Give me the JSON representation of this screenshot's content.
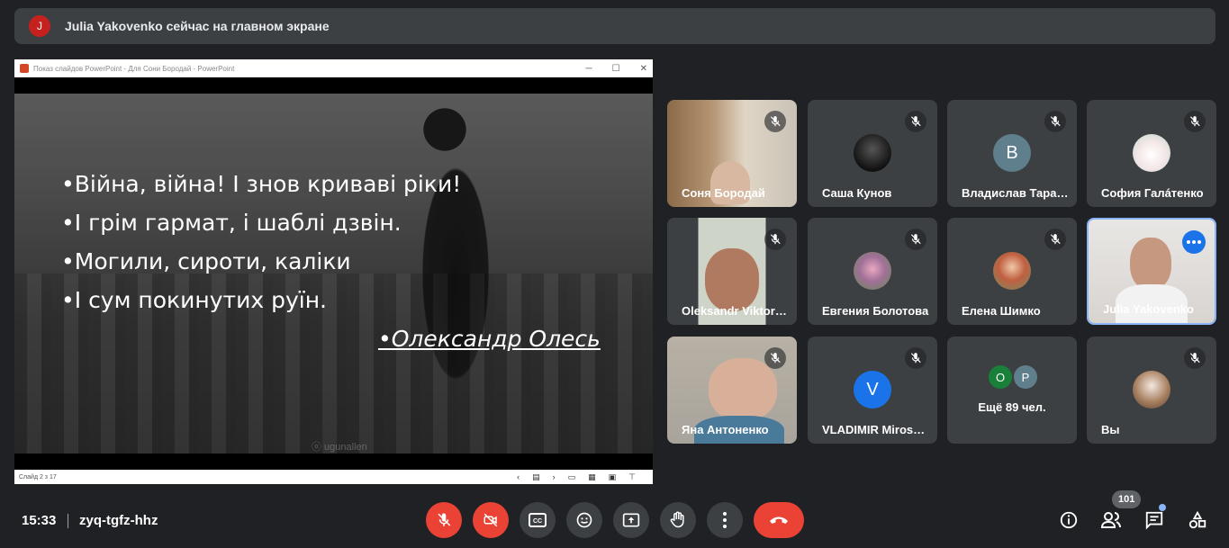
{
  "banner": {
    "avatar_letter": "J",
    "text": "Julia Yakovenko сейчас на главном экране"
  },
  "presentation": {
    "window_title": "Показ слайдов PowerPoint - Для Сони Бородай - PowerPoint",
    "lines": [
      "•Війна, війна! І знов криваві ріки!",
      "•І грім гармат, і шаблі дзвін.",
      "•Могили, сироти, каліки",
      "•І сум покинутих руїн."
    ],
    "author": "•Олександр Олесь",
    "watermark": "ⓞ ugunallen",
    "status": "Слайд 2 з 17"
  },
  "participants": [
    {
      "name": "Соня Бородай",
      "type": "video"
    },
    {
      "name": "Саша Кунов",
      "type": "photo"
    },
    {
      "name": "Владислав Тарасов",
      "type": "letter",
      "letter": "B",
      "color": "#5f7f8d"
    },
    {
      "name": "София Галáтенко",
      "type": "photo"
    },
    {
      "name": "Oleksandr Viktorovich",
      "type": "video"
    },
    {
      "name": "Евгения Болотова",
      "type": "photo"
    },
    {
      "name": "Елена Шимко",
      "type": "photo"
    },
    {
      "name": "Julia Yakovenko",
      "type": "video",
      "active": true
    },
    {
      "name": "Яна Антоненко",
      "type": "video"
    },
    {
      "name": "VLADIMIR Miroshnichenko",
      "type": "letter",
      "letter": "V",
      "color": "#1a73e8"
    },
    {
      "name": "Ещё 89 чел.",
      "type": "group",
      "letters": [
        "O",
        "P"
      ]
    },
    {
      "name": "Вы",
      "type": "photo"
    }
  ],
  "footer": {
    "time": "15:33",
    "meeting_code": "zyq-tgfz-hhz",
    "participant_count": "101"
  },
  "colors": {
    "background": "#202124",
    "tile": "#3c4043",
    "danger": "#ea4335",
    "accent": "#1a73e8"
  }
}
